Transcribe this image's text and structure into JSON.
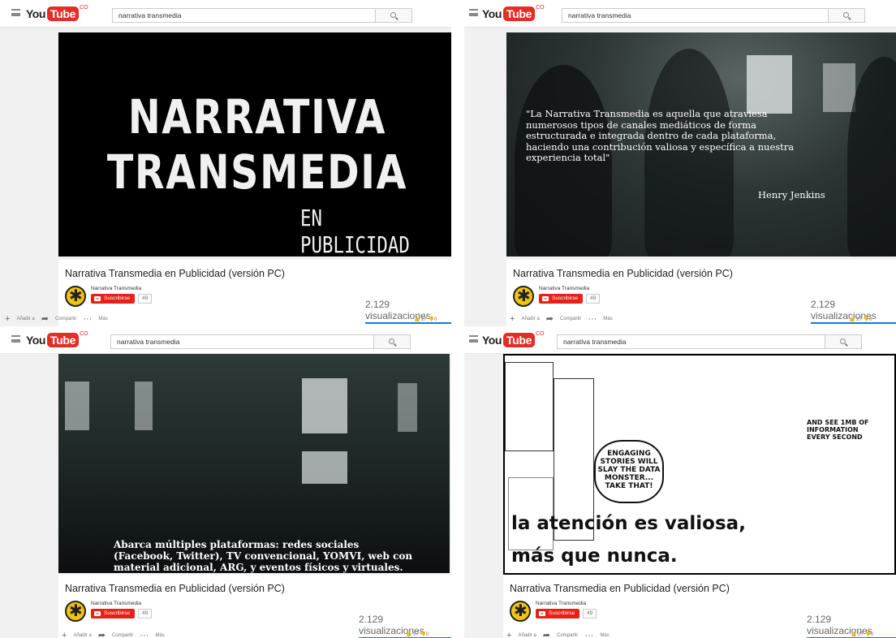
{
  "header": {
    "logo_you": "You",
    "logo_tube": "Tube",
    "logo_co": "CO",
    "search_query": "narrativa transmedia"
  },
  "video_info": {
    "title": "Narrativa Transmedia en Publicidad (versión PC)",
    "channel": "Narrativa Transmedia",
    "subscribe_label": "Suscribirse",
    "subscriber_count": "49",
    "views": "2.129 visualizaciones",
    "add_label": "Añadir a",
    "share_label": "Compartir",
    "more_label": "Más",
    "like_count": "27",
    "dislike_count": "0"
  },
  "frames": {
    "f1_line1": "NARRATIVA",
    "f1_line2": "TRANSMEDIA",
    "f1_line3": "EN PUBLICIDAD",
    "f2_quote": "\"La Narrativa Transmedia es aquella que atraviesa numerosos tipos de canales mediáticos de forma estructurada e integrada dentro de cada plataforma, haciendo una contribución valiosa y específica a nuestra experiencia total\"",
    "f2_author": "Henry Jenkins",
    "f3_caption": "Abarca múltiples plataformas: redes sociales (Facebook, Twitter), TV convencional, YOMVI, web con material adicional, ARG, y eventos físicos y virtuales.",
    "f4_bubble": "ENGAGING STORIES WILL SLAY THE DATA MONSTER... TAKE THAT!",
    "f4_side": "AND SEE 1MB OF INFORMATION EVERY SECOND",
    "f4_line1": "la atención es valiosa,",
    "f4_line2": "más que nunca."
  },
  "colors": {
    "youtube_red": "#e52d27",
    "subscribe_red": "#e62117",
    "views_underline": "#167ac6"
  },
  "icons": [
    "menu-icon",
    "search-icon",
    "subscribe-play-icon",
    "add-icon",
    "share-icon",
    "more-icon",
    "like-icon",
    "dislike-icon"
  ]
}
